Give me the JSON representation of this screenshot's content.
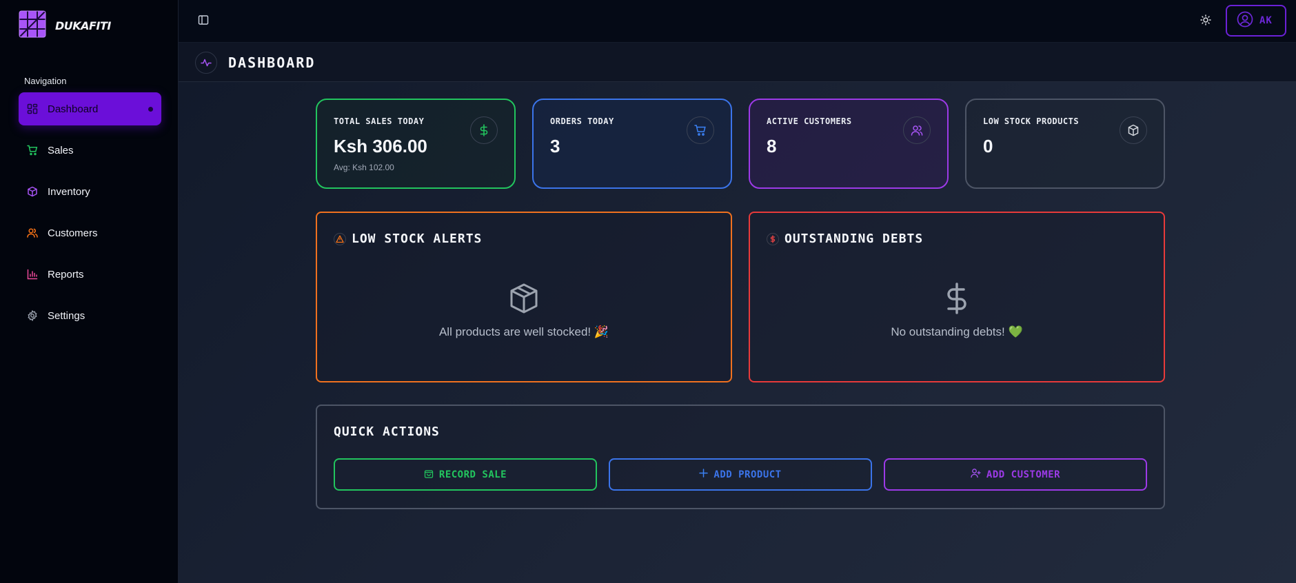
{
  "brand": {
    "name": "DUKAFITI"
  },
  "sidebar": {
    "section_title": "Navigation",
    "items": [
      {
        "label": "Dashboard",
        "icon": "grid-icon",
        "color": "#1a0640"
      },
      {
        "label": "Sales",
        "icon": "cart-icon",
        "color": "#22c55e"
      },
      {
        "label": "Inventory",
        "icon": "box-icon",
        "color": "#a855f7"
      },
      {
        "label": "Customers",
        "icon": "users-icon",
        "color": "#f97316"
      },
      {
        "label": "Reports",
        "icon": "bar-chart-icon",
        "color": "#ec4899"
      },
      {
        "label": "Settings",
        "icon": "gear-icon",
        "color": "#9ca3af"
      }
    ]
  },
  "topbar": {
    "user_initials": "AK"
  },
  "page": {
    "title": "DASHBOARD"
  },
  "stats": [
    {
      "label": "TOTAL SALES TODAY",
      "value": "Ksh 306.00",
      "sub": "Avg: Ksh 102.00",
      "icon": "dollar-icon",
      "color": "#22c55e"
    },
    {
      "label": "ORDERS TODAY",
      "value": "3",
      "icon": "cart-icon",
      "color": "#3b82f6"
    },
    {
      "label": "ACTIVE CUSTOMERS",
      "value": "8",
      "icon": "users-icon",
      "color": "#a855f7"
    },
    {
      "label": "LOW STOCK PRODUCTS",
      "value": "0",
      "icon": "box-icon",
      "color": "#d1d5db"
    }
  ],
  "panels": {
    "low_stock": {
      "title": "LOW STOCK ALERTS",
      "message": "All products are well stocked! 🎉",
      "accent": "#f0711f"
    },
    "debts": {
      "title": "OUTSTANDING DEBTS",
      "message": "No outstanding debts! 💚",
      "accent": "#e83a3a"
    }
  },
  "quick_actions": {
    "title": "QUICK ACTIONS",
    "record_sale": "RECORD SALE",
    "add_product": "ADD PRODUCT",
    "add_customer": "ADD CUSTOMER"
  }
}
